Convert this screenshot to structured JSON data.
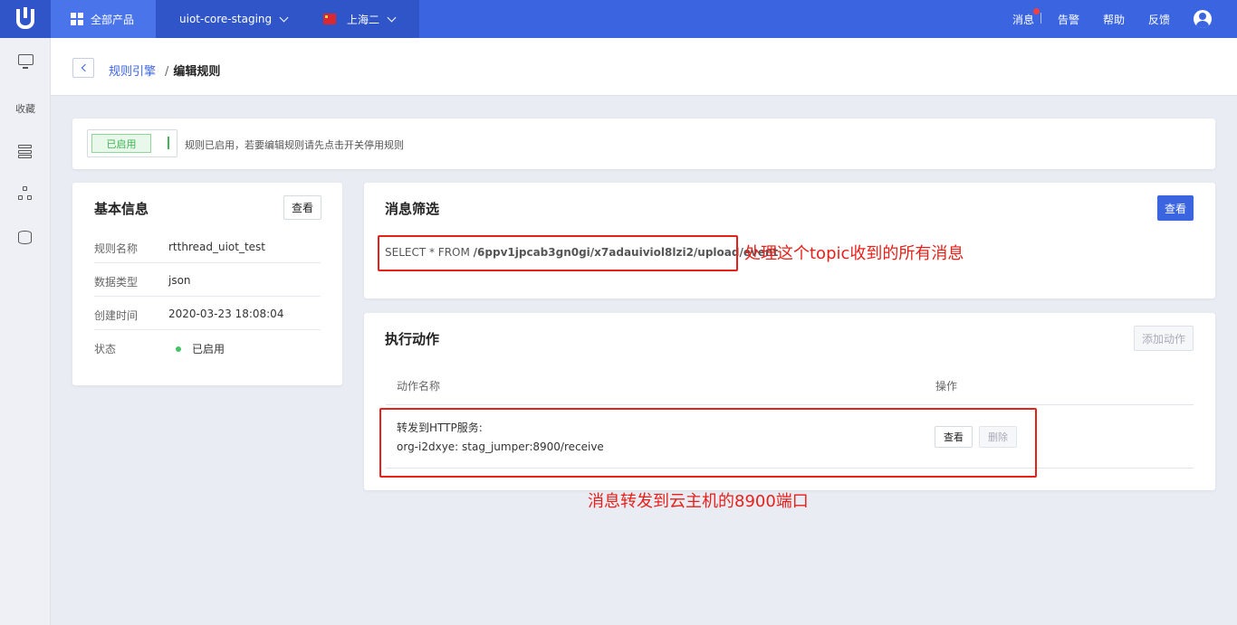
{
  "topbar": {
    "products_label": "全部产品",
    "project_label": "uiot-core-staging",
    "region_label": "上海二",
    "messages_label": "消息",
    "alerts_label": "告警",
    "help_label": "帮助",
    "feedback_label": "反馈"
  },
  "sidebar": {
    "favorites_label": "收藏"
  },
  "breadcrumb": {
    "parent": "规则引擎",
    "separator": "/",
    "current": "编辑规则"
  },
  "status": {
    "toggle_label": "已启用",
    "message": "规则已启用，若要编辑规则请先点击开关停用规则"
  },
  "basic_info": {
    "title": "基本信息",
    "view_button": "查看",
    "rows": [
      {
        "key": "规则名称",
        "value": "rtthread_uiot_test"
      },
      {
        "key": "数据类型",
        "value": "json"
      },
      {
        "key": "创建时间",
        "value": "2020-03-23 18:08:04"
      },
      {
        "key": "状态",
        "value": "已启用"
      }
    ]
  },
  "filter": {
    "title": "消息筛选",
    "view_button": "查看",
    "sql_prefix": "SELECT * FROM ",
    "sql_topic": "/6ppv1jpcab3gn0gi/x7adauiviol8lzi2/upload/event",
    "annotation": "处理这个topic收到的所有消息"
  },
  "actions": {
    "title": "执行动作",
    "add_button": "添加动作",
    "columns": [
      "动作名称",
      "操作"
    ],
    "rows": [
      {
        "name": "转发到HTTP服务:",
        "detail": "org-i2dxye: stag_jumper:8900/receive",
        "view_button": "查看",
        "delete_button": "删除"
      }
    ],
    "annotation": "消息转发到云主机的8900端口"
  },
  "colors": {
    "brand": "#3b64e0",
    "annotation": "#e8201a",
    "enabled_green": "#45c466"
  }
}
